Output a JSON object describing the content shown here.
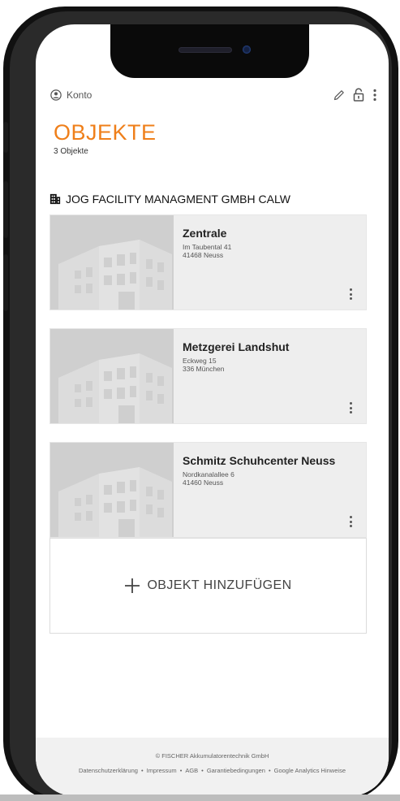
{
  "topbar": {
    "account_label": "Konto"
  },
  "page": {
    "title": "OBJEKTE",
    "count_label": "3 Objekte"
  },
  "company": {
    "name": "JOG FACILITY MANAGMENT GMBH CALW"
  },
  "objects": [
    {
      "name": "Zentrale",
      "street": "Im Taubental 41",
      "city": "41468 Neuss"
    },
    {
      "name": "Metzgerei Landshut",
      "street": "Eckweg 15",
      "city": "336 München"
    },
    {
      "name": "Schmitz Schuhcenter Neuss",
      "street": "Nordkanalallee 6",
      "city": "41460 Neuss"
    }
  ],
  "add_button": {
    "label": "OBJEKT HINZUFÜGEN"
  },
  "footer": {
    "copyright": "© FISCHER Akkumulatorentechnik GmbH",
    "links": [
      "Datenschutzerklärung",
      "Impressum",
      "AGB",
      "Garantiebedingungen",
      "Google Analytics Hinweise"
    ],
    "separator": "•"
  },
  "colors": {
    "accent": "#ef7f1a",
    "card_background": "#eeeeee",
    "footer_background": "#f1f1f1"
  },
  "icons": {
    "account": "user-circle-icon",
    "edit": "pencil-icon",
    "lock": "unlock-icon",
    "more": "more-vertical-icon",
    "company": "building-icon",
    "add": "plus-icon"
  }
}
